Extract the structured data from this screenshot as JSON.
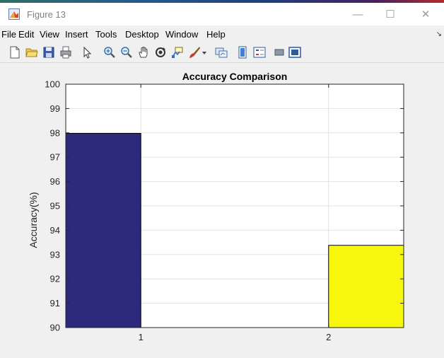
{
  "window": {
    "title": "Figure 13",
    "controls": [
      "—",
      "☐",
      "✕"
    ]
  },
  "menu": {
    "items": [
      "File",
      "Edit",
      "View",
      "Insert",
      "Tools",
      "Desktop",
      "Window",
      "Help"
    ]
  },
  "toolbar": {
    "icons": [
      "new-figure-icon",
      "open-file-icon",
      "save-icon",
      "print-icon",
      "pointer-icon",
      "zoom-in-icon",
      "zoom-out-icon",
      "pan-hand-icon",
      "rotate-3d-icon",
      "data-cursor-icon",
      "brush-icon",
      "brush-dropdown-icon",
      "link-plot-icon",
      "insert-colorbar-icon",
      "insert-legend-icon",
      "hide-plot-tools-icon",
      "show-plot-tools-icon"
    ]
  },
  "colors": {
    "bar1": "#2b2a7c",
    "bar2": "#f7f70e",
    "axes_bg": "#ffffff",
    "figure_bg": "#f0f0f0",
    "grid": "#e2e2e2"
  },
  "chart_data": {
    "type": "bar",
    "title": "Accuracy Comparison",
    "xlabel": "",
    "ylabel": "Accuracy(%)",
    "categories": [
      "1",
      "2"
    ],
    "series": [
      {
        "values": [
          97.98,
          null
        ]
      },
      {
        "values": [
          null,
          93.38
        ]
      }
    ],
    "ylim": [
      90,
      100
    ],
    "yticks": [
      "90",
      "91",
      "92",
      "93",
      "94",
      "95",
      "96",
      "97",
      "98",
      "99",
      "100"
    ],
    "xticks": [
      "1",
      "2"
    ],
    "grid": true,
    "legend": "none"
  }
}
